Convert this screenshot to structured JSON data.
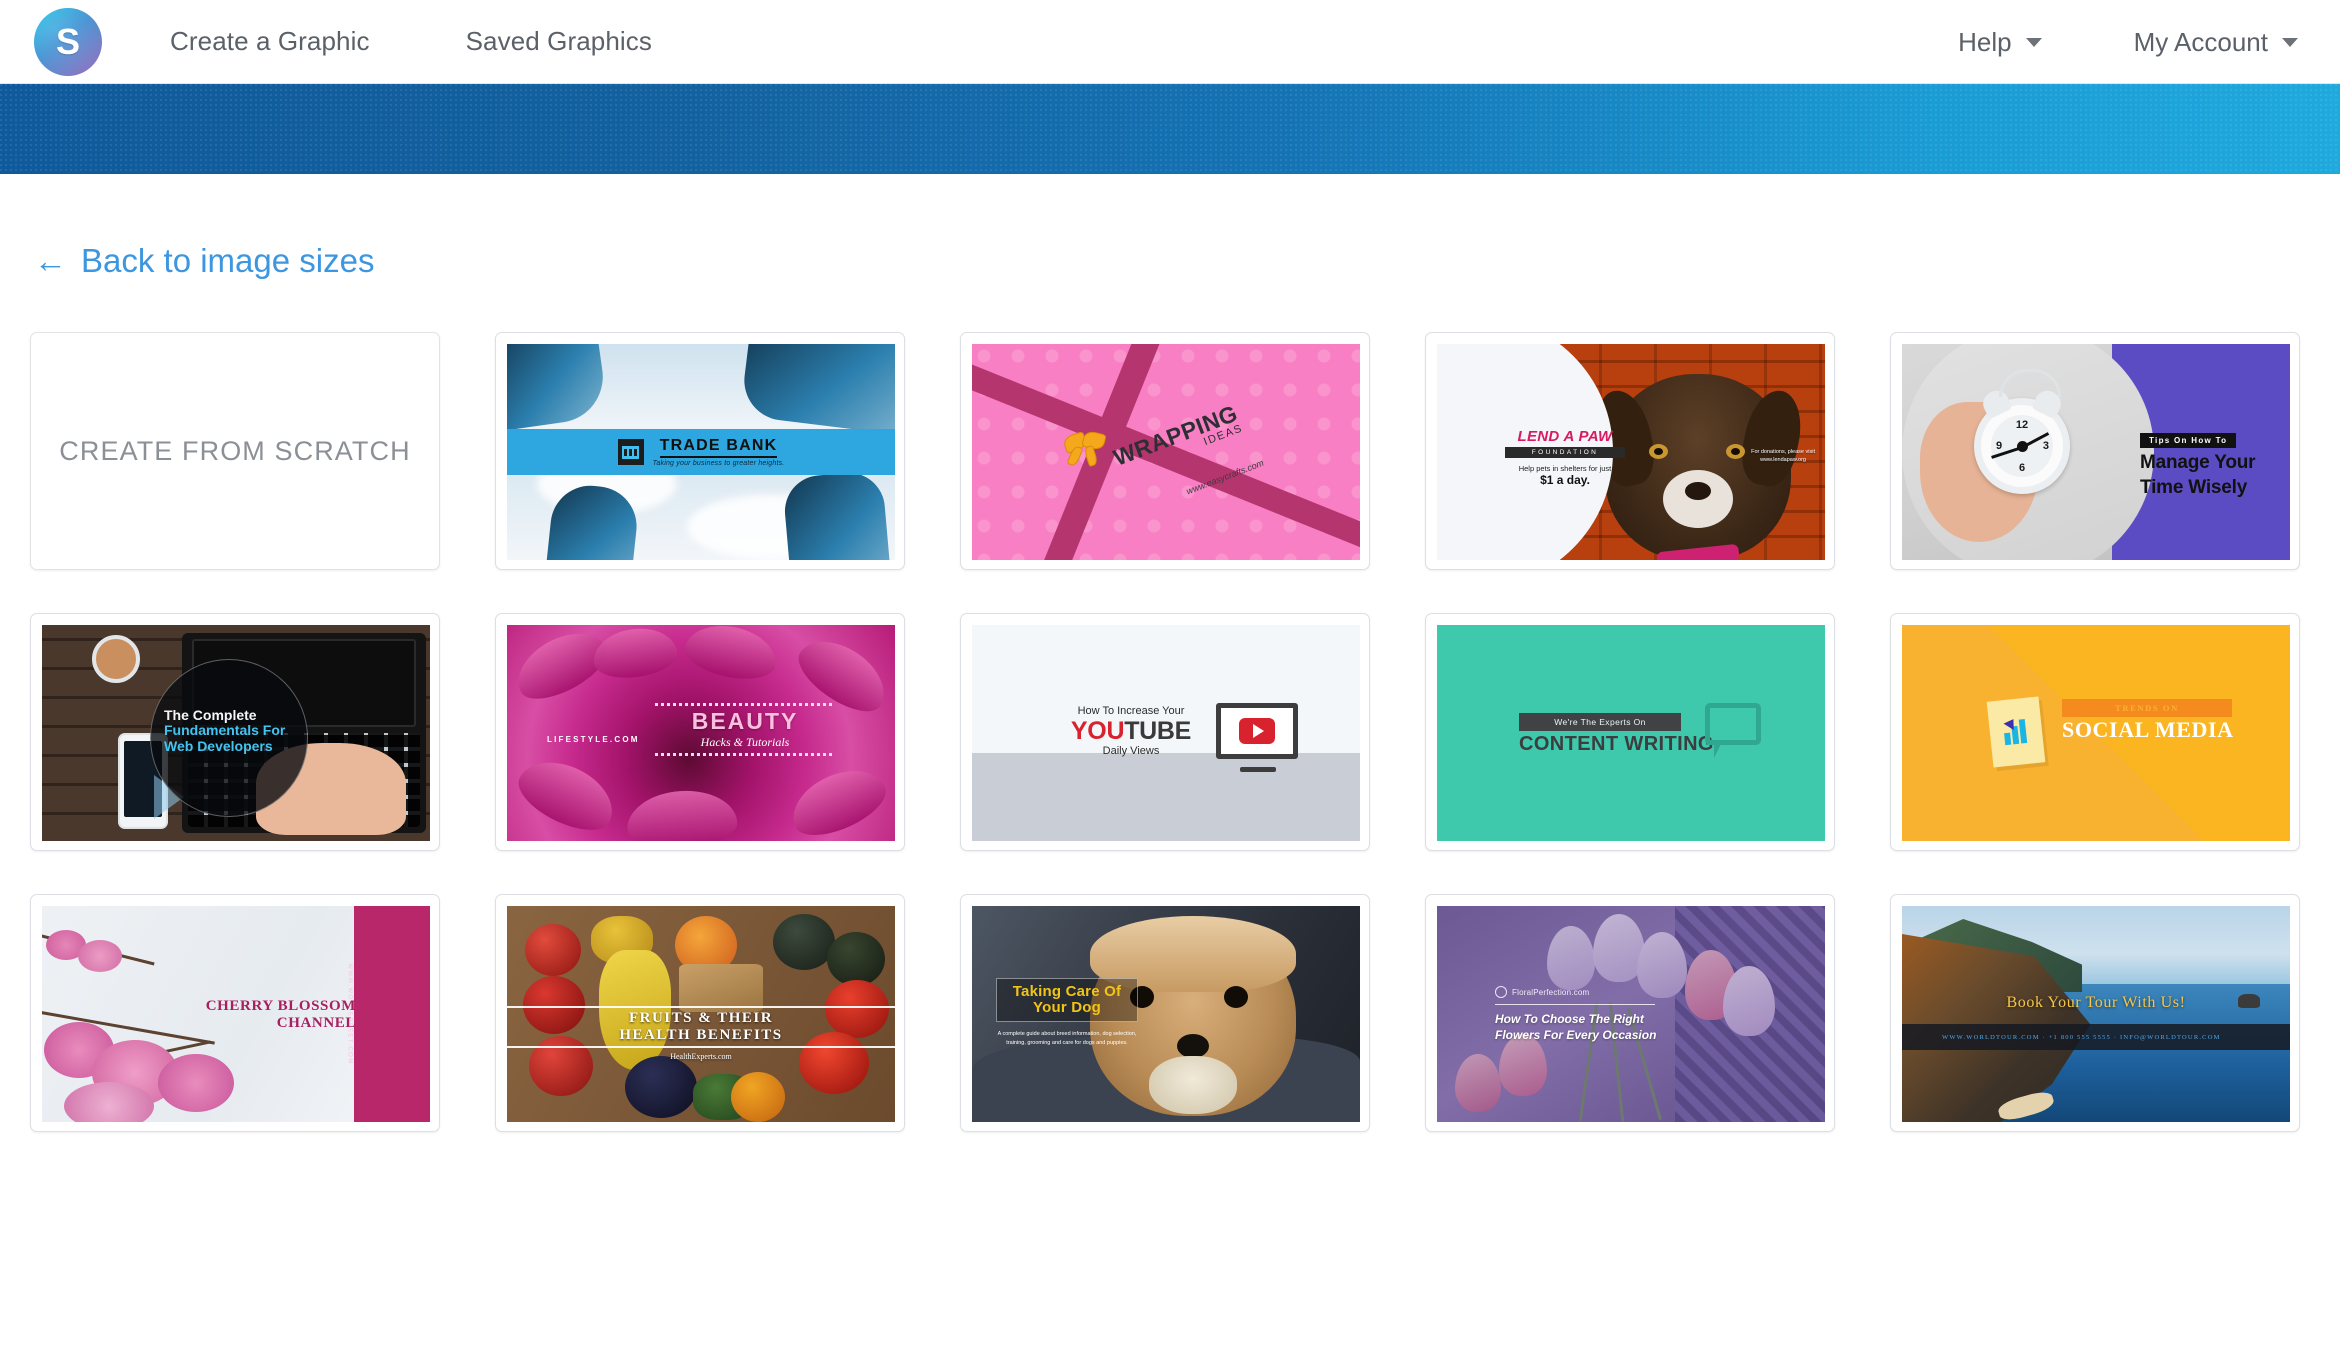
{
  "header": {
    "logo_letter": "S",
    "nav": [
      {
        "label": "Create a Graphic"
      },
      {
        "label": "Saved Graphics"
      }
    ],
    "right": [
      {
        "label": "Help"
      },
      {
        "label": "My Account"
      }
    ]
  },
  "back_link": {
    "arrow": "←",
    "label": "Back to image sizes"
  },
  "scratch": {
    "label": "CREATE FROM SCRATCH"
  },
  "templates": [
    {
      "name": "trade-bank",
      "title": "TRADE BANK",
      "subtitle": "Taking your business to greater heights."
    },
    {
      "name": "wrapping-ideas",
      "title": "WRAPPING",
      "subtitle": "IDEAS",
      "url": "www.easycrafts.com"
    },
    {
      "name": "lend-a-paw",
      "title": "LEND A PAW",
      "badge": "FOUNDATION",
      "line1": "Help pets in shelters for just",
      "line2": "$1 a day.",
      "donation_line1": "For donations, please visit",
      "donation_line2": "www.lendapaw.org"
    },
    {
      "name": "manage-your-time",
      "kicker": "Tips On How To",
      "title_line1": "Manage Your",
      "title_line2": "Time Wisely",
      "clock_numbers": [
        "12",
        "3",
        "6",
        "9"
      ]
    },
    {
      "name": "web-developers",
      "line1": "The Complete",
      "line2": "Fundamentals For",
      "line3": "Web Developers"
    },
    {
      "name": "beauty-hacks",
      "brand": "LIFESTYLE.COM",
      "title": "BEAUTY",
      "subtitle": "Hacks & Tutorials"
    },
    {
      "name": "youtube-views",
      "line1": "How To Increase Your",
      "title_part1": "YOU",
      "title_part2": "TUBE",
      "line3": "Daily Views"
    },
    {
      "name": "content-writing",
      "kicker": "We're The Experts On",
      "title": "CONTENT WRITING"
    },
    {
      "name": "social-media",
      "kicker": "TRENDS ON",
      "title": "SOCIAL MEDIA"
    },
    {
      "name": "cherry-blossom",
      "title_line1": "CHERRY BLOSSOM",
      "title_line2": "CHANNEL",
      "url": "WWW.WONDERFEET.COM"
    },
    {
      "name": "fruits-health",
      "title_line1": "FRUITS & THEIR",
      "title_line2": "HEALTH BENEFITS",
      "url": "HealthExperts.com"
    },
    {
      "name": "taking-care-of-your-dog",
      "title_line1": "Taking Care Of",
      "title_line2": "Your Dog",
      "subtitle": "A complete guide about breed information, dog selection, training, grooming and care for dogs and puppies."
    },
    {
      "name": "choose-right-flowers",
      "brand": "FloralPerfection.com",
      "title_line1": "How To Choose The Right",
      "title_line2": "Flowers For Every Occasion"
    },
    {
      "name": "book-your-tour",
      "title": "Book Your Tour With Us!",
      "contact": "WWW.WORLDTOUR.COM   ·   +1 800 555 5555   ·   INFO@WORLDTOUR.COM"
    }
  ],
  "colors": {
    "link": "#3d96e0",
    "band_left": "#0f5a9c",
    "band_right": "#1fa9dd",
    "tile_border": "#dcdfe3"
  }
}
